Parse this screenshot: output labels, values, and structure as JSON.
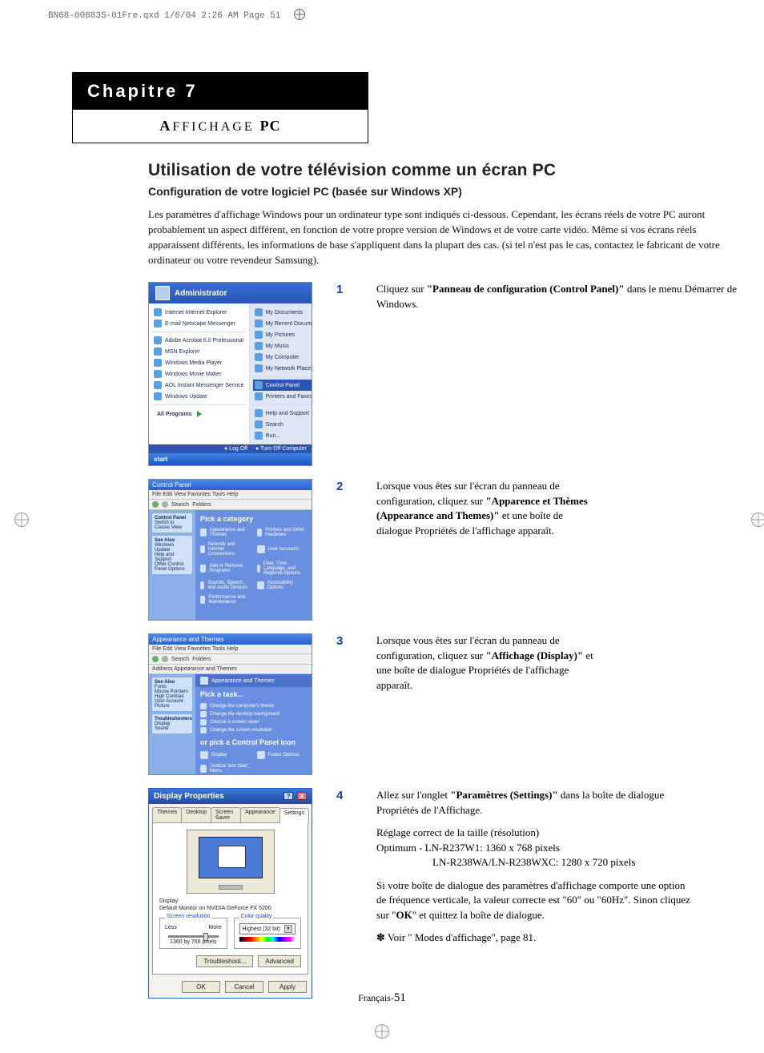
{
  "print_header": "BN68-00883S-01Fre.qxd  1/6/04 2:26 AM  Page 51",
  "chapter": {
    "title": "Chapitre 7",
    "sub_pre": "A",
    "sub_rest": "FFICHAGE",
    "sub_pc": "PC"
  },
  "main_heading": "Utilisation de votre télévision comme un écran PC",
  "sub_heading": "Configuration de votre logiciel PC (basée sur Windows XP)",
  "intro": "Les paramètres d'affichage Windows pour un ordinateur type sont indiqués ci-dessous. Cependant, les écrans réels de votre PC auront probablement un aspect différent, en fonction de votre propre version de Windows et de votre carte vidéo. Même si vos écrans réels apparaissent différents, les informations de base s'appliquent dans la plupart des cas. (si tel n'est pas le cas, contactez le fabricant de votre ordinateur ou votre revendeur Samsung).",
  "steps": {
    "s1": {
      "num": "1",
      "pre": "Cliquez sur ",
      "bold": "\"Panneau de configuration (Control Panel)\"",
      "post": " dans le menu Démarrer de Windows."
    },
    "s2": {
      "num": "2",
      "pre": "Lorsque vous êtes sur l'écran du panneau de configuration, cliquez sur ",
      "bold": "\"Apparence et Thèmes (Appearance and Themes)\"",
      "post": " et une boîte de dialogue Propriétés de l'affichage apparaît."
    },
    "s3": {
      "num": "3",
      "pre": "Lorsque vous êtes sur l'écran du panneau de configuration, cliquez  sur ",
      "bold": "\"Affichage (Display)\"",
      "post": " et une boîte de dialogue Propriétés de l'affichage apparaît."
    },
    "s4": {
      "num": "4",
      "pre": "Allez sur l'onglet ",
      "bold": "\"Paramètres (Settings)\"",
      "post": " dans la boîte de dialogue Propriétés de l'Affichage.",
      "res_hdr": "Réglage correct de la taille (résolution)",
      "res1": "Optimum - LN-R237W1: 1360 x 768 pixels",
      "res2": "LN-R238WA/LN-R238WXC: 1280 x 720 pixels",
      "freq_pre": "Si votre boîte de dialogue des paramètres d'affichage comporte une option de fréquence verticale, la valeur correcte est \"60\" ou \"60Hz\". Sinon cliquez sur \"",
      "freq_bold": "OK",
      "freq_post": "\" et quittez la boîte de dialogue.",
      "note": "✽ Voir \" Modes d'affichage\", page 81."
    }
  },
  "start_menu": {
    "user": "Administrator",
    "left": [
      "Internet\nInternet Explorer",
      "E-mail\nNetscape Messenger",
      "Adobe Acrobat 6.0 Professional",
      "MSN Explorer",
      "Windows Media Player",
      "Windows Movie Maker",
      "AOL Instant Messenger Service",
      "Windows Update"
    ],
    "all_programs": "All Programs",
    "right_top": [
      "My Documents",
      "My Recent Documents  ▸",
      "My Pictures",
      "My Music",
      "My Computer",
      "My Network Places"
    ],
    "right_hl": "Control Panel",
    "right_bottom": [
      "Printers and Faxes",
      "Help and Support",
      "Search",
      "Run..."
    ],
    "logoff": "Log Off",
    "shutdown": "Turn Off Computer",
    "start": "start"
  },
  "cp": {
    "title": "Control Panel",
    "menu": "File  Edit  View  Favorites  Tools  Help",
    "side_hdr": "Control Panel",
    "side1": "Switch to Classic View",
    "see_also": "See Also",
    "see_items": [
      "Windows Update",
      "Help and Support",
      "Other Control Panel Options"
    ],
    "cat_hdr": "Pick a category",
    "cats": [
      "Appearance and Themes",
      "Printers and Other Hardware",
      "Network and Internet Connections",
      "User Accounts",
      "Add or Remove Programs",
      "Date, Time, Language, and Regional Options",
      "Sounds, Speech, and Audio Devices",
      "Accessibility Options",
      "Performance and Maintenance",
      ""
    ]
  },
  "at": {
    "title": "Appearance and Themes",
    "menu": "File  Edit  View  Favorites  Tools  Help",
    "crumb": "Address  Appearance and Themes",
    "side_hdr": "See Also",
    "side_items": [
      "Fonts",
      "Mouse Pointers",
      "High Contrast",
      "User Account Picture"
    ],
    "trouble_hdr": "Troubleshooters",
    "trouble_items": [
      "Display",
      "Sound"
    ],
    "strip": "Appearance and Themes",
    "task_hdr": "Pick a task...",
    "tasks": [
      "Change the computer's theme",
      "Change the desktop background",
      "Choose a screen saver",
      "Change the screen resolution"
    ],
    "icon_hdr": "or pick a Control Panel icon",
    "icons": [
      "Display",
      "Folder Options",
      "Taskbar and Start Menu",
      ""
    ]
  },
  "dlg": {
    "title": "Display Properties",
    "tabs": [
      "Themes",
      "Desktop",
      "Screen Saver",
      "Appearance",
      "Settings"
    ],
    "display_lbl": "Display:",
    "display_val": "Default Monitor on NVIDIA GeForce FX 5200",
    "sr_legend": "Screen resolution",
    "less": "Less",
    "more": "More",
    "res_val": "1360 by 768 pixels",
    "cq_legend": "Color quality",
    "cq_val": "Highest (32 bit)",
    "btn_trouble": "Troubleshoot...",
    "btn_adv": "Advanced",
    "ok": "OK",
    "cancel": "Cancel",
    "apply": "Apply"
  },
  "footer": {
    "lang": "Français-",
    "page": "51"
  }
}
